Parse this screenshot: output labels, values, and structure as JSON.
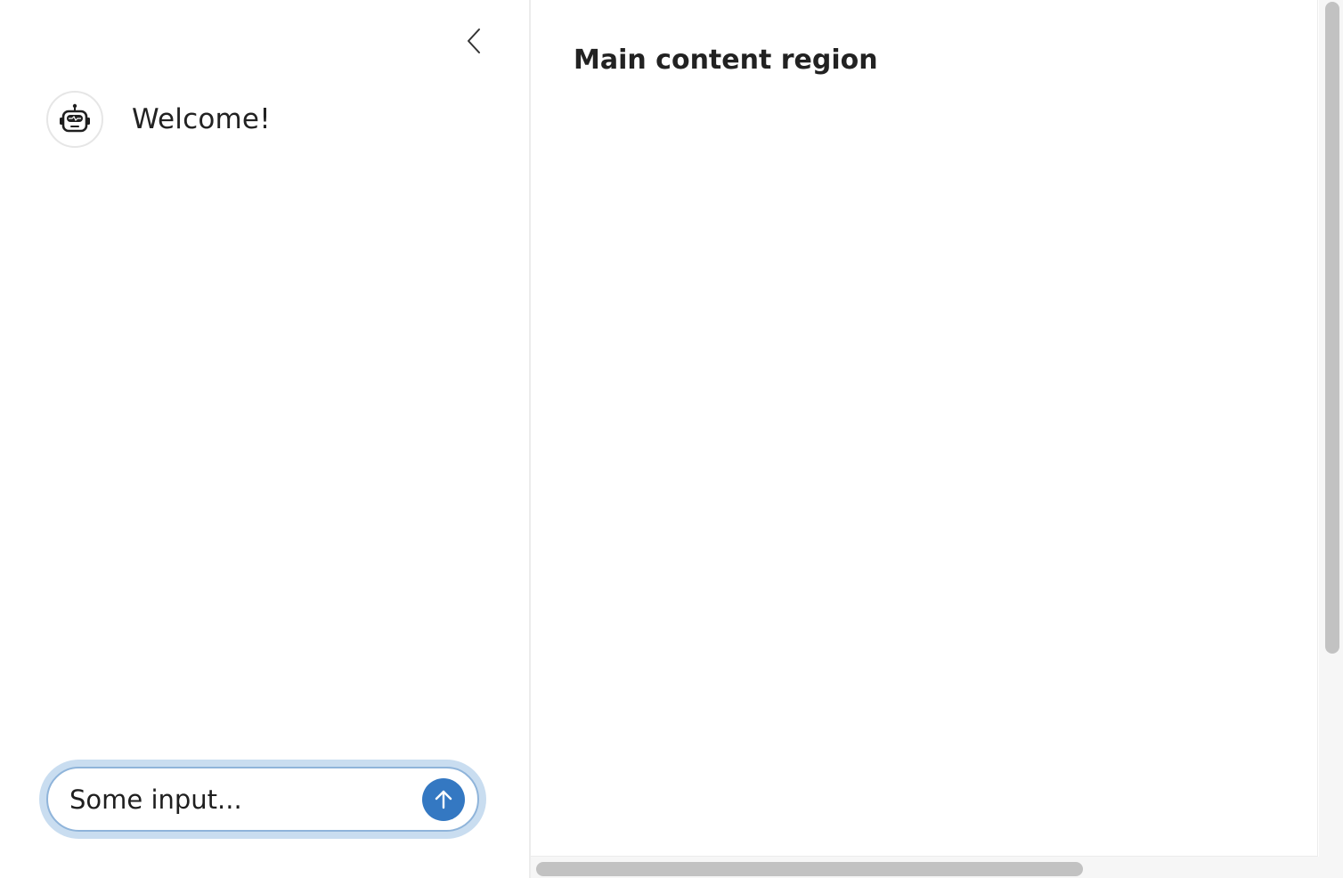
{
  "sidebar": {
    "collapse_icon": "chevron-left-icon",
    "avatar_icon": "robot-icon",
    "welcome_text": "Welcome!",
    "input": {
      "placeholder": "Some input...",
      "value": "Some input...",
      "send_icon": "arrow-up-icon"
    }
  },
  "main": {
    "title": "Main content region"
  },
  "colors": {
    "accent": "#3478c2",
    "input_border": "#8fb4da",
    "input_halo": "#c9ddf0",
    "scrollbar_thumb": "#c2c2c2"
  }
}
